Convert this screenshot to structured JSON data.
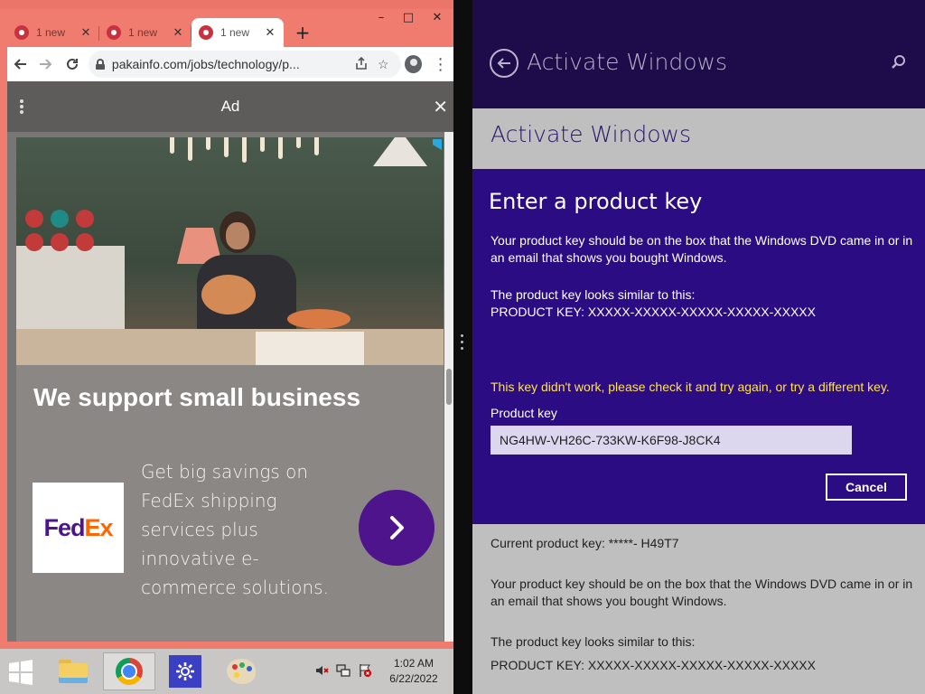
{
  "chrome": {
    "tabs": [
      {
        "label": "1 new"
      },
      {
        "label": "1 new"
      },
      {
        "label": "1 new"
      }
    ],
    "active_tab_index": 2,
    "url": "pakainfo.com/jobs/technology/p..."
  },
  "ad": {
    "bar_label": "Ad",
    "headline": "We support small business",
    "brand": {
      "fed": "Fed",
      "ex": "Ex"
    },
    "body": "Get big savings on FedEx shipping services plus innovative e-commerce solutions.",
    "brand_colors": {
      "purple": "#4d148c",
      "orange": "#ff6600"
    }
  },
  "pc_settings": {
    "header_title": "Activate Windows",
    "page_title": "Activate Windows",
    "dialog": {
      "heading": "Enter a product key",
      "text1": "Your product key should be on the box that the Windows DVD came in or in an email that shows you bought Windows.",
      "text2_line1": "The product key looks similar to this:",
      "text2_line2": "PRODUCT KEY: XXXXX-XXXXX-XXXXX-XXXXX-XXXXX",
      "error": "This key didn't work, please check it and try again, or try a different key.",
      "field_label": "Product key",
      "field_value": "NG4HW-VH26C-733KW-K6F98-J8CK4",
      "cancel_label": "Cancel"
    },
    "current_key": "Current product key: *****- H49T7",
    "info_text": "Your product key should be on the box that the Windows DVD came in or in an email that shows you bought Windows.",
    "info2_line1": "The product key looks similar to this:",
    "info2_line2": "PRODUCT KEY: XXXXX-XXXXX-XXXXX-XXXXX-XXXXX",
    "colors": {
      "header": "#1d0b4a",
      "dialog": "#2c0c82",
      "error": "#ffe24a"
    }
  },
  "taskbar": {
    "time": "1:02 AM",
    "date": "6/22/2022"
  }
}
